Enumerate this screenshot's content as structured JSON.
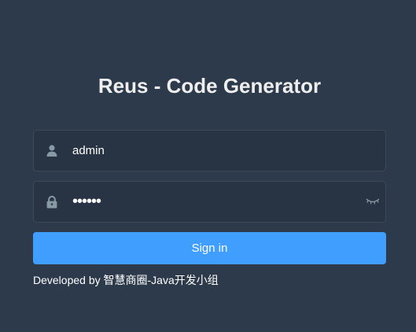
{
  "title": "Reus - Code Generator",
  "username": {
    "value": "admin",
    "icon": "user-icon"
  },
  "password": {
    "value": "••••••",
    "icon": "lock-icon",
    "toggle_icon": "eye-closed-icon"
  },
  "signin": {
    "label": "Sign in"
  },
  "footer": {
    "developed_by": "Developed by 智慧商圈-Java开发小组"
  },
  "colors": {
    "background": "#2d3a4b",
    "primary": "#409eff",
    "title": "#eeeeee",
    "icon": "#889aa4"
  }
}
